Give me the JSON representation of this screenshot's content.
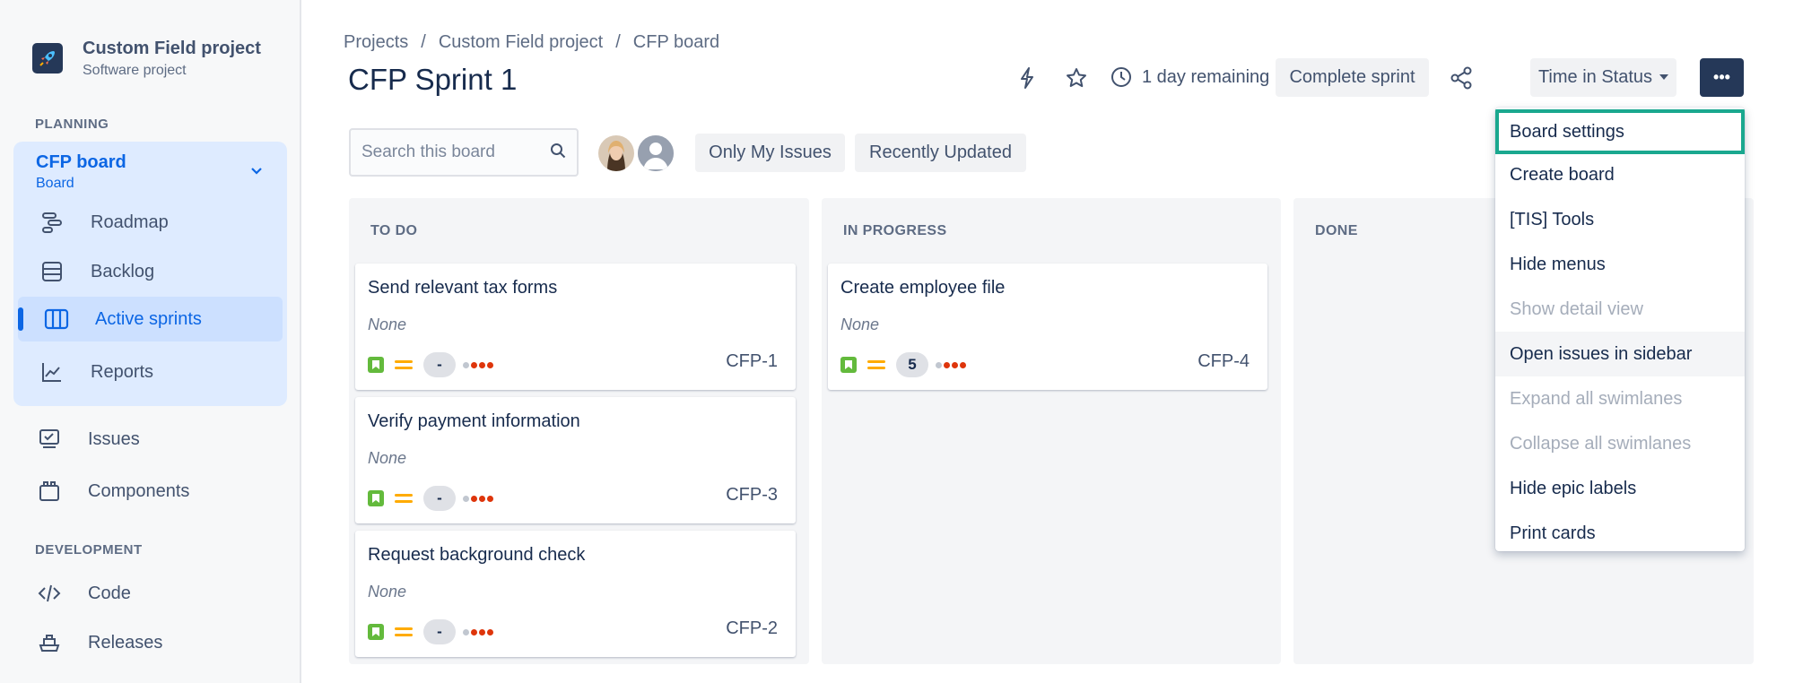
{
  "project": {
    "name": "Custom Field project",
    "type": "Software project"
  },
  "sidebar": {
    "planning_label": "PLANNING",
    "board": {
      "title": "CFP board",
      "subtitle": "Board"
    },
    "planning_items": [
      {
        "label": "Roadmap",
        "icon": "roadmap-icon"
      },
      {
        "label": "Backlog",
        "icon": "backlog-icon"
      },
      {
        "label": "Active sprints",
        "icon": "active-sprints-icon",
        "active": true
      },
      {
        "label": "Reports",
        "icon": "reports-icon"
      }
    ],
    "items": [
      {
        "label": "Issues",
        "icon": "issues-icon"
      },
      {
        "label": "Components",
        "icon": "components-icon"
      }
    ],
    "development_label": "DEVELOPMENT",
    "dev_items": [
      {
        "label": "Code",
        "icon": "code-icon"
      },
      {
        "label": "Releases",
        "icon": "releases-icon"
      }
    ]
  },
  "breadcrumbs": [
    "Projects",
    "/",
    "Custom Field project",
    "/",
    "CFP board"
  ],
  "header": {
    "title": "CFP Sprint 1",
    "remaining": "1 day remaining",
    "complete_sprint": "Complete sprint",
    "time_in_status": "Time in Status",
    "more": "•••"
  },
  "toolbar": {
    "search_placeholder": "Search this board",
    "only_my_issues": "Only My Issues",
    "recently_updated": "Recently Updated"
  },
  "columns": [
    {
      "title": "TO DO",
      "cards": [
        {
          "title": "Send relevant tax forms",
          "epic": "None",
          "estimate": "-",
          "key": "CFP-1"
        },
        {
          "title": "Verify payment information",
          "epic": "None",
          "estimate": "-",
          "key": "CFP-3"
        },
        {
          "title": "Request background check",
          "epic": "None",
          "estimate": "-",
          "key": "CFP-2"
        }
      ]
    },
    {
      "title": "IN PROGRESS",
      "cards": [
        {
          "title": "Create employee file",
          "epic": "None",
          "estimate": "5",
          "key": "CFP-4"
        }
      ]
    },
    {
      "title": "DONE",
      "cards": []
    }
  ],
  "menu": {
    "items": [
      {
        "label": "Board settings",
        "state": "focus"
      },
      {
        "label": "Create board",
        "state": "normal"
      },
      {
        "label": "[TIS] Tools",
        "state": "normal"
      },
      {
        "label": "Hide menus",
        "state": "normal"
      },
      {
        "label": "Show detail view",
        "state": "disabled"
      },
      {
        "label": "Open issues in sidebar",
        "state": "hover"
      },
      {
        "label": "Expand all swimlanes",
        "state": "disabled"
      },
      {
        "label": "Collapse all swimlanes",
        "state": "disabled"
      },
      {
        "label": "Hide epic labels",
        "state": "normal"
      },
      {
        "label": "Print cards",
        "state": "normal"
      }
    ]
  },
  "colors": {
    "accent": "#0c66e4",
    "focus_ring": "#1aa88f",
    "story": "#63ba3c",
    "priority": "#ffab00"
  }
}
